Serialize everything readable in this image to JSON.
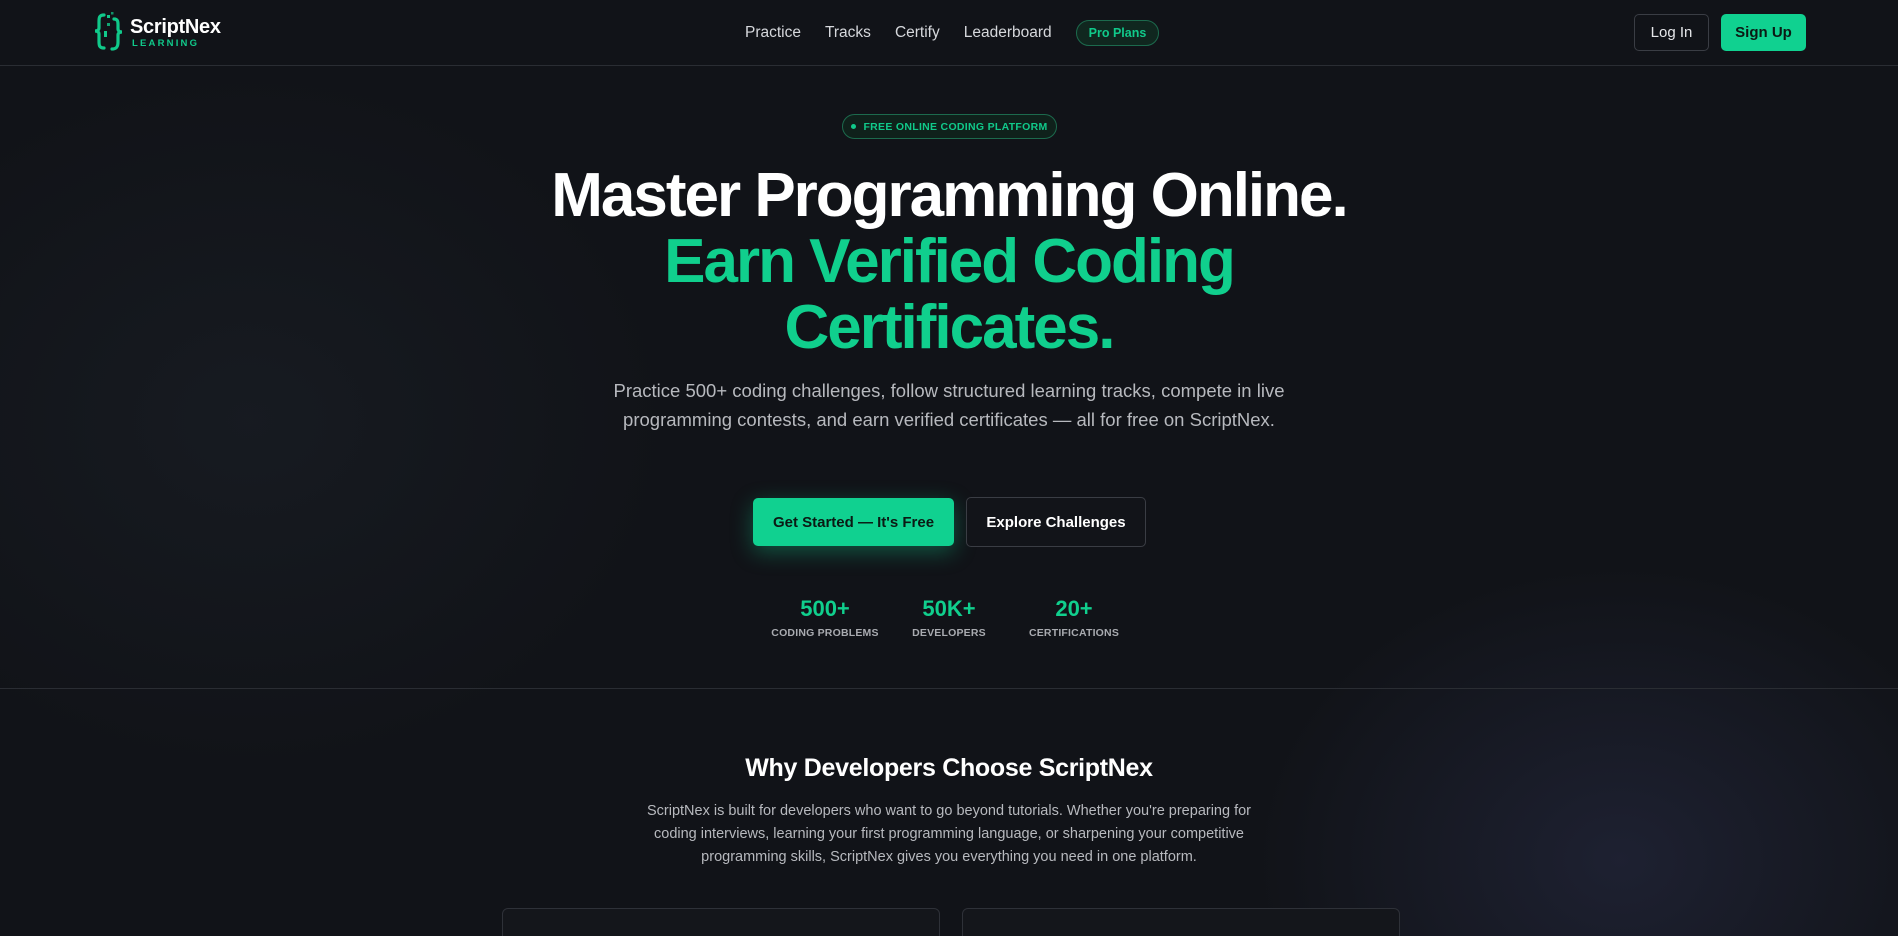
{
  "brand": {
    "name": "ScriptNex",
    "subtitle": "LEARNING"
  },
  "nav": {
    "links": [
      "Practice",
      "Tracks",
      "Certify",
      "Leaderboard"
    ],
    "pro_label": "Pro Plans",
    "login_label": "Log In",
    "signup_label": "Sign Up"
  },
  "hero": {
    "badge": "FREE ONLINE CODING PLATFORM",
    "title_line1": "Master Programming Online.",
    "title_line2": "Earn Verified Coding",
    "title_line3": "Certificates.",
    "description": "Practice 500+ coding challenges, follow structured learning tracks, compete in live programming contests, and earn verified certificates — all for free on ScriptNex.",
    "primary_cta": "Get Started — It's Free",
    "secondary_cta": "Explore Challenges",
    "stats": [
      {
        "value": "500+",
        "label": "CODING PROBLEMS"
      },
      {
        "value": "50K+",
        "label": "DEVELOPERS"
      },
      {
        "value": "20+",
        "label": "CERTIFICATIONS"
      }
    ]
  },
  "why": {
    "title": "Why Developers Choose ScriptNex",
    "text": "ScriptNex is built for developers who want to go beyond tutorials. Whether you're preparing for coding interviews, learning your first programming language, or sharpening your competitive programming skills, ScriptNex gives you everything you need in one platform."
  },
  "colors": {
    "accent": "#10d190",
    "background": "#111318",
    "text_muted": "#b7b9be"
  },
  "icons": {
    "logo": "curly-braces-logo-icon",
    "badge_dot": "dot-icon"
  }
}
